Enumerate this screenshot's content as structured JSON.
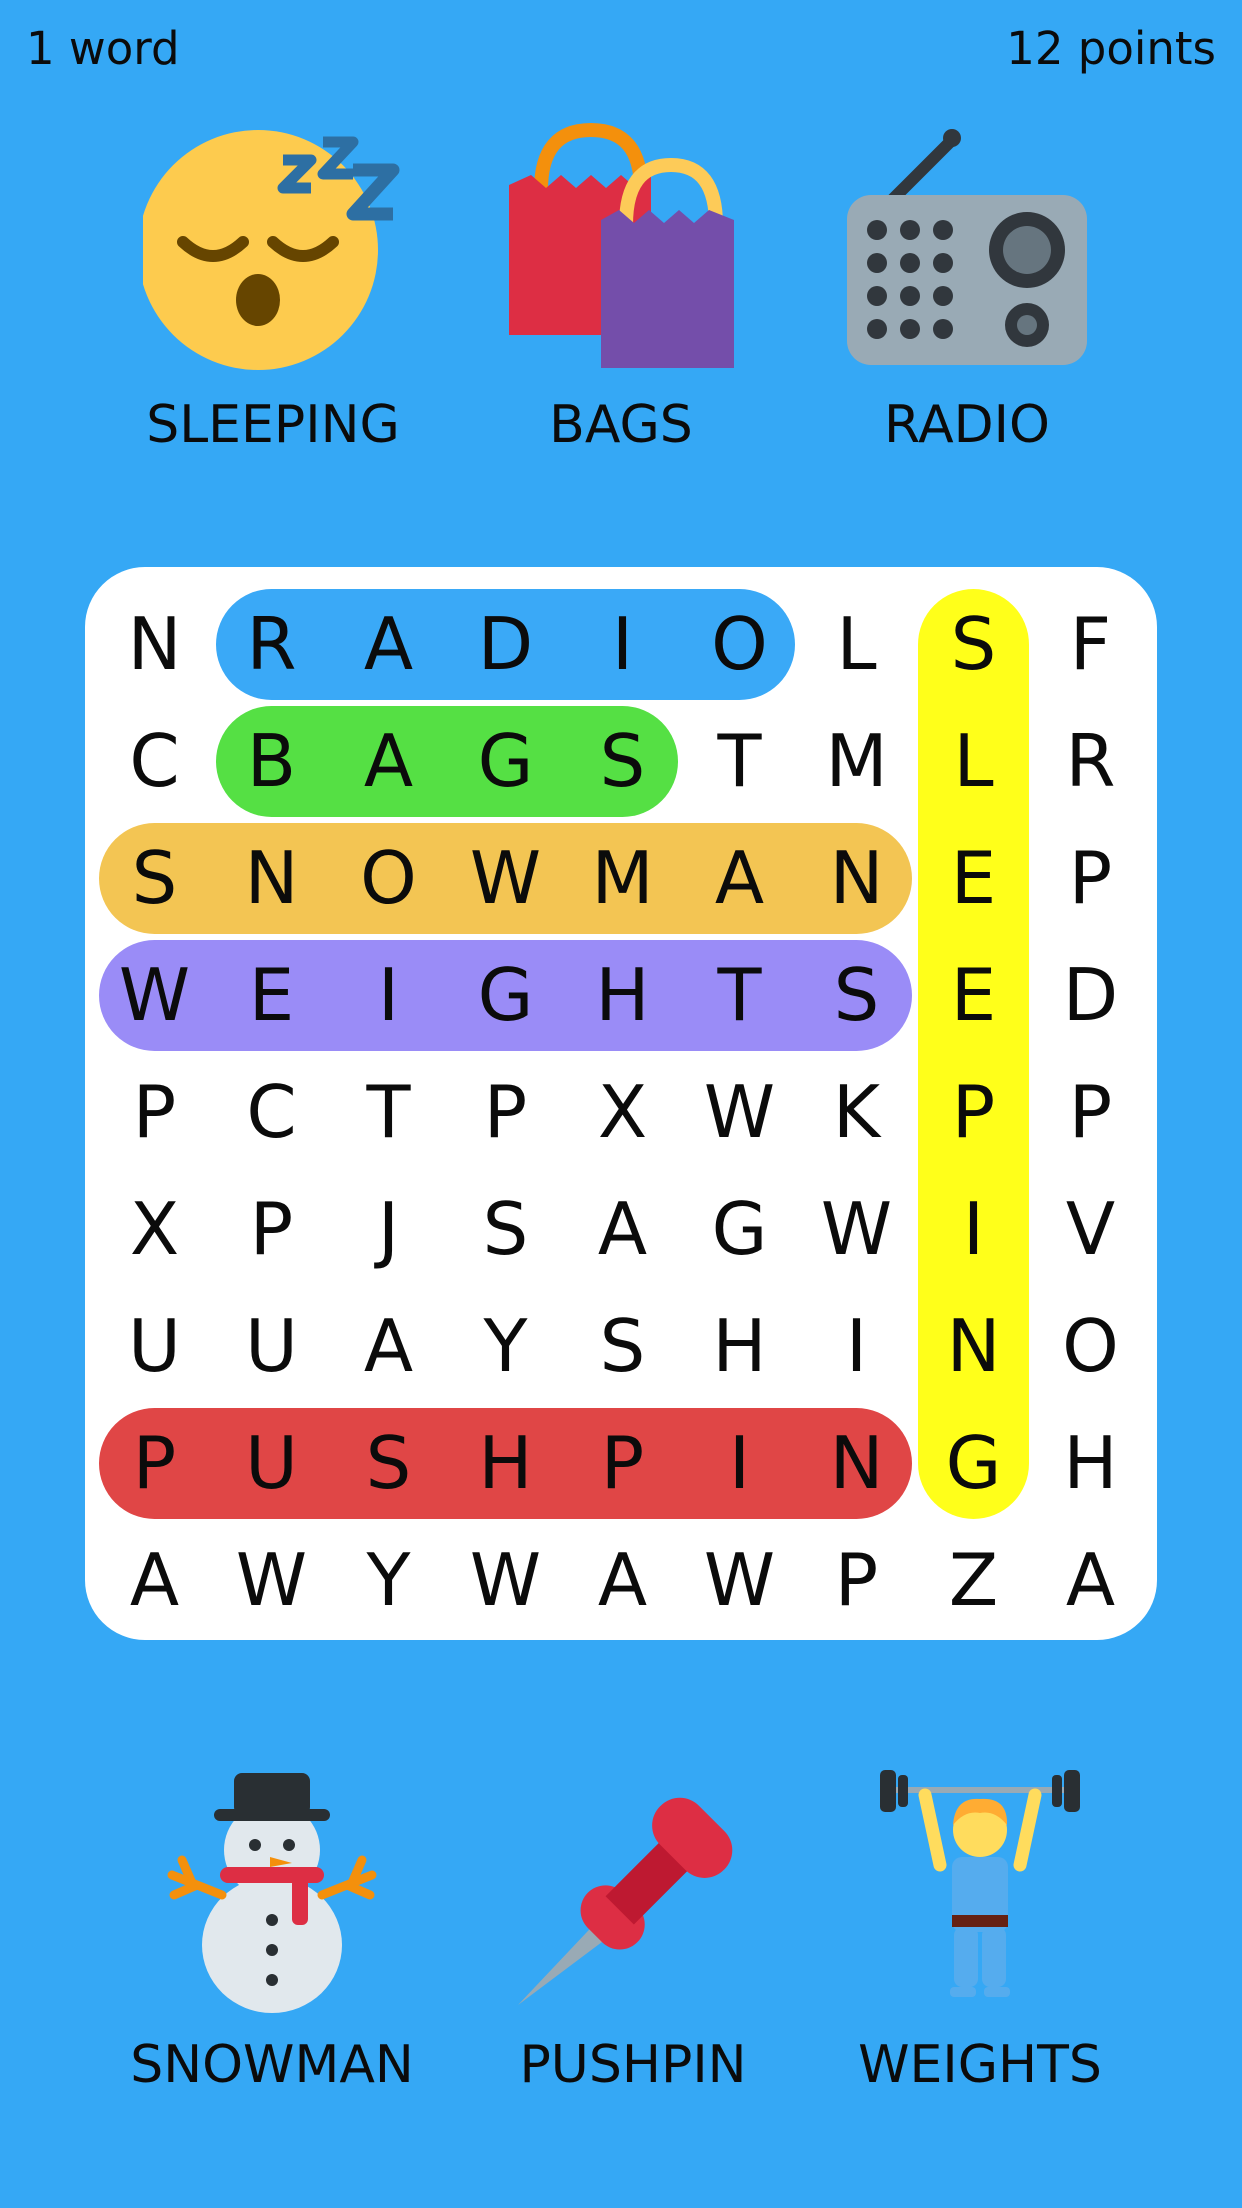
{
  "hud": {
    "words": "1 word",
    "points": "12 points"
  },
  "clues_top": [
    {
      "label": "SLEEPING",
      "icon": "sleeping-face-icon"
    },
    {
      "label": "BAGS",
      "icon": "shopping-bags-icon"
    },
    {
      "label": "RADIO",
      "icon": "radio-icon"
    }
  ],
  "clues_bottom": [
    {
      "label": "SNOWMAN",
      "icon": "snowman-icon"
    },
    {
      "label": "PUSHPIN",
      "icon": "pushpin-icon"
    },
    {
      "label": "WEIGHTS",
      "icon": "weightlifter-icon"
    }
  ],
  "grid": [
    [
      "N",
      "R",
      "A",
      "D",
      "I",
      "O",
      "L",
      "S",
      "F"
    ],
    [
      "C",
      "B",
      "A",
      "G",
      "S",
      "T",
      "M",
      "L",
      "R"
    ],
    [
      "S",
      "N",
      "O",
      "W",
      "M",
      "A",
      "N",
      "E",
      "P"
    ],
    [
      "W",
      "E",
      "I",
      "G",
      "H",
      "T",
      "S",
      "E",
      "D"
    ],
    [
      "P",
      "C",
      "T",
      "P",
      "X",
      "W",
      "K",
      "P",
      "P"
    ],
    [
      "X",
      "P",
      "J",
      "S",
      "A",
      "G",
      "W",
      "I",
      "V"
    ],
    [
      "U",
      "U",
      "A",
      "Y",
      "S",
      "H",
      "I",
      "N",
      "O"
    ],
    [
      "P",
      "U",
      "S",
      "H",
      "P",
      "I",
      "N",
      "G",
      "H"
    ],
    [
      "A",
      "W",
      "Y",
      "W",
      "A",
      "W",
      "P",
      "Z",
      "A"
    ]
  ],
  "found_words": [
    {
      "word": "RADIO",
      "row": 0,
      "col": 1,
      "dir": "horizontal",
      "length": 5,
      "color": "#3aa9f7"
    },
    {
      "word": "BAGS",
      "row": 1,
      "col": 1,
      "dir": "horizontal",
      "length": 4,
      "color": "#55e044"
    },
    {
      "word": "SNOWMAN",
      "row": 2,
      "col": 0,
      "dir": "horizontal",
      "length": 7,
      "color": "#f3c553"
    },
    {
      "word": "WEIGHTS",
      "row": 3,
      "col": 0,
      "dir": "horizontal",
      "length": 7,
      "color": "#9a8cf7"
    },
    {
      "word": "PUSHPIN",
      "row": 7,
      "col": 0,
      "dir": "horizontal",
      "length": 7,
      "color": "#e04646"
    },
    {
      "word": "SLEEPING",
      "row": 0,
      "col": 7,
      "dir": "vertical",
      "length": 8,
      "color": "#ffff1a"
    }
  ]
}
